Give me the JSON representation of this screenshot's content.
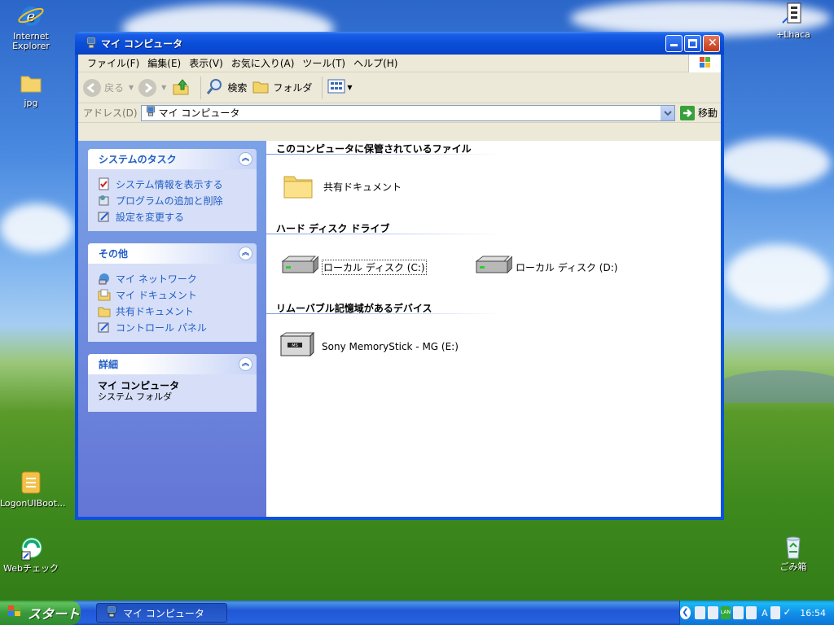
{
  "desktop": {
    "icons": {
      "ie": "Internet Explorer",
      "jpg": "jpg",
      "logon": "LogonUIBoot...",
      "webcheck": "Webチェック",
      "lhaca": "+Lhaca",
      "recycle": "ごみ箱"
    }
  },
  "window": {
    "title": "マイ コンピュータ",
    "menu": [
      "ファイル(F)",
      "編集(E)",
      "表示(V)",
      "お気に入り(A)",
      "ツール(T)",
      "ヘルプ(H)"
    ],
    "toolbar": {
      "back": "戻る",
      "search": "検索",
      "folders": "フォルダ"
    },
    "address": {
      "label": "アドレス(D)",
      "value": "マイ コンピュータ",
      "go": "移動"
    },
    "panels": {
      "system_tasks": {
        "title": "システムのタスク",
        "items": [
          "システム情報を表示する",
          "プログラムの追加と削除",
          "設定を変更する"
        ]
      },
      "other": {
        "title": "その他",
        "items": [
          "マイ ネットワーク",
          "マイ ドキュメント",
          "共有ドキュメント",
          "コントロール パネル"
        ]
      },
      "details": {
        "title": "詳細",
        "name": "マイ コンピュータ",
        "type": "システム フォルダ"
      }
    },
    "groups": {
      "stored_files": {
        "title": "このコンピュータに保管されているファイル",
        "items": [
          "共有ドキュメント"
        ]
      },
      "hard_drives": {
        "title": "ハード ディスク ドライブ",
        "items": [
          "ローカル ディスク (C:)",
          "ローカル ディスク (D:)"
        ]
      },
      "removable": {
        "title": "リムーバブル記憶域があるデバイス",
        "items": [
          "Sony MemoryStick - MG (E:)"
        ]
      }
    }
  },
  "taskbar": {
    "start": "スタート",
    "task": "マイ コンピュータ",
    "clock": "16:54",
    "tray_lan": "LAN",
    "tray_ime": "A"
  }
}
